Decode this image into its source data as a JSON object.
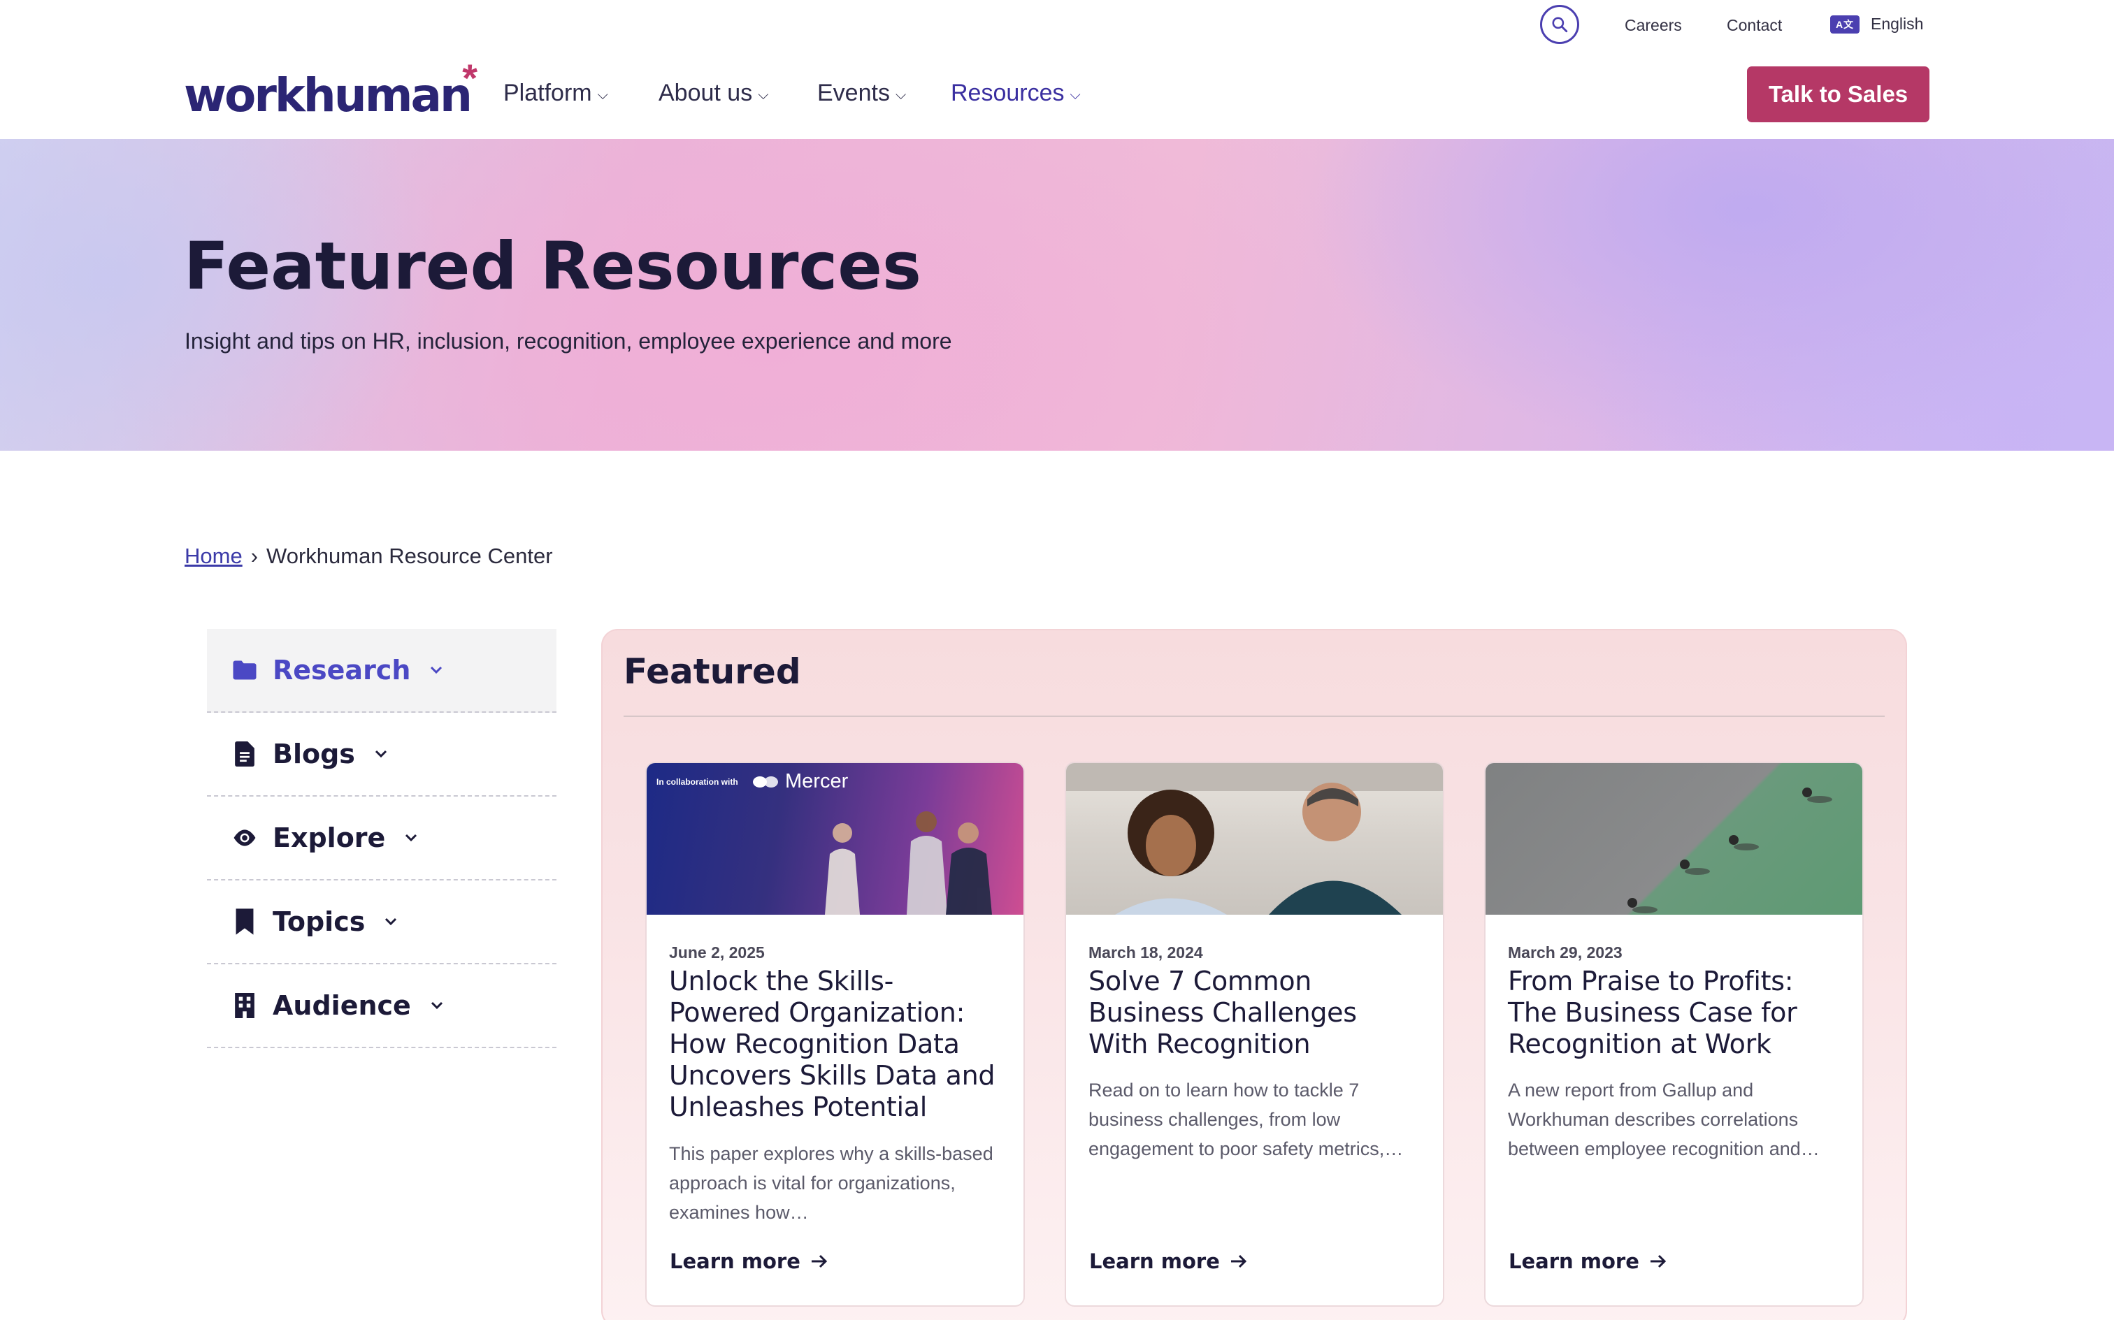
{
  "util": {
    "careers": "Careers",
    "contact": "Contact",
    "language": "English"
  },
  "brand": {
    "logo_text": "workhuman"
  },
  "nav": {
    "platform": "Platform",
    "about": "About us",
    "events": "Events",
    "resources": "Resources",
    "cta": "Talk to Sales"
  },
  "hero": {
    "title": "Featured Resources",
    "subtitle": "Insight and tips on HR, inclusion, recognition, employee experience and more"
  },
  "breadcrumb": {
    "home": "Home",
    "separator": "›",
    "current": "Workhuman Resource Center"
  },
  "sidebar": {
    "items": [
      {
        "label": "Research",
        "icon": "folder-icon"
      },
      {
        "label": "Blogs",
        "icon": "document-icon"
      },
      {
        "label": "Explore",
        "icon": "eye-icon"
      },
      {
        "label": "Topics",
        "icon": "bookmark-icon"
      },
      {
        "label": "Audience",
        "icon": "building-icon"
      }
    ]
  },
  "featured": {
    "title": "Featured",
    "cards": [
      {
        "image_collab_text": "In collaboration with",
        "image_logo_text": "Mercer",
        "date": "June 2, 2025",
        "title": "Unlock the Skills-Powered Organization: How Recognition Data Uncovers Skills Data and Unleashes Potential",
        "description": "This paper explores why a skills-based approach is vital for organizations, examines how…",
        "link": "Learn more"
      },
      {
        "date": "March 18, 2024",
        "title": "Solve 7 Common Business Challenges With Recognition",
        "description": "Read on to learn how to tackle 7 business challenges, from low engagement to poor safety metrics,…",
        "link": "Learn more"
      },
      {
        "date": "March 29, 2023",
        "title": "From Praise to Profits: The Business Case for Recognition at Work",
        "description": "A new report from Gallup and Workhuman describes correlations between employee recognition and…",
        "link": "Learn more"
      }
    ]
  },
  "colors": {
    "brand_navy": "#2b2574",
    "brand_magenta": "#b53866",
    "accent_purple": "#4b48c4"
  }
}
